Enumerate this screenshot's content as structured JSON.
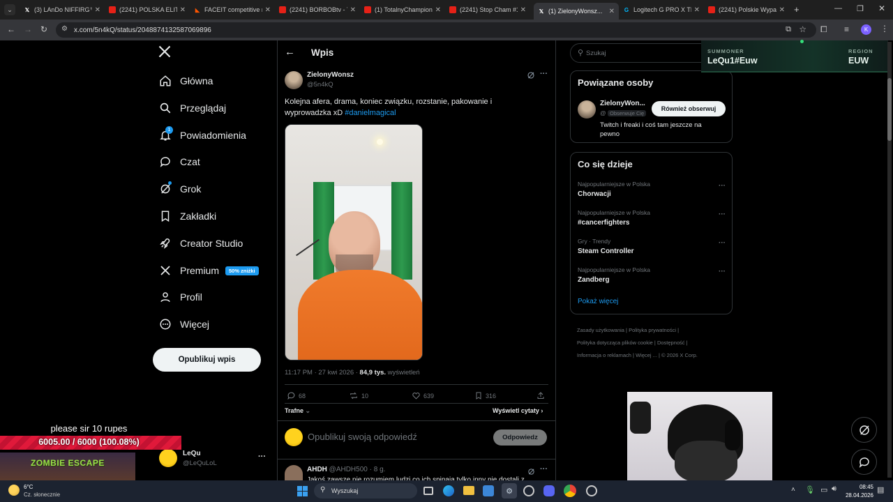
{
  "browser": {
    "tabs": [
      {
        "title": "(3) LAnDo NIFFIRG™...",
        "favicon": "x"
      },
      {
        "title": "(2241) POLSKA ELITA",
        "favicon": "yt"
      },
      {
        "title": "FACEIT competitive m...",
        "favicon": "fc"
      },
      {
        "title": "(2241) BORBOBtv - Yo...",
        "favicon": "yt"
      },
      {
        "title": "(1) TotalnyChampion...",
        "favicon": "yt"
      },
      {
        "title": "(2241) Stop Cham #1...",
        "favicon": "yt"
      },
      {
        "title": "(1) ZielonyWonsz...",
        "favicon": "x",
        "active": true
      },
      {
        "title": "Logitech G PRO X TK...",
        "favicon": "lg"
      },
      {
        "title": "(2241) Polskie Wypad...",
        "favicon": "yt"
      }
    ],
    "url": "x.com/5n4kQ/status/2048874132587069896",
    "profile_initial": "K"
  },
  "nav": {
    "logo": "X",
    "items": [
      {
        "label": "Główna",
        "icon": "home-icon"
      },
      {
        "label": "Przeglądaj",
        "icon": "search-icon"
      },
      {
        "label": "Powiadomienia",
        "icon": "bell-icon",
        "badge": "1"
      },
      {
        "label": "Czat",
        "icon": "chat-icon"
      },
      {
        "label": "Grok",
        "icon": "grok-icon"
      },
      {
        "label": "Zakładki",
        "icon": "bookmark-icon"
      },
      {
        "label": "Creator Studio",
        "icon": "rocket-icon"
      },
      {
        "label": "Premium",
        "icon": "x-premium-icon",
        "badge": "50% zniżki"
      },
      {
        "label": "Profil",
        "icon": "person-icon"
      },
      {
        "label": "Więcej",
        "icon": "more-circle-icon"
      }
    ],
    "post_button": "Opublikuj wpis",
    "account": {
      "name": "LeQu",
      "handle": "@LeQuLoL",
      "more": "···"
    }
  },
  "post": {
    "header_title": "Wpis",
    "author_name": "ZielonyWonsz",
    "author_handle": "@5n4kQ",
    "text": "Kolejna afera, drama, koniec związku, rozstanie, pakowanie i wyprowadzka xD ",
    "hashtag": "#danielmagical",
    "time": "11:17 PM · 27 kwi 2026 · ",
    "views_count": "84,9 tys.",
    "views_label": " wyświetleń",
    "stats": {
      "replies": "68",
      "reposts": "10",
      "likes": "639",
      "bookmarks": "316"
    },
    "sort_label": "Trafne",
    "quotes_label": "Wyświetl cytaty",
    "reply_placeholder": "Opublikuj swoją odpowiedź",
    "reply_button": "Odpowiedz",
    "next_reply": {
      "name": "AHDH",
      "handle": "@AHDH500 · 8 g.",
      "text": "Jakoś zawsze nie rozumiem ludzi co ich spinają tylko inny nie dostali z..."
    }
  },
  "sidebar": {
    "search_placeholder": "Szukaj",
    "related": {
      "title": "Powiązane osoby",
      "name": "ZielonyWon...",
      "handle": "@",
      "follows_you": "Obserwuje Cię",
      "follow_button": "Również obserwuj",
      "bio": "Twitch i freaki i coś tam jeszcze na pewno"
    },
    "trends_title": "Co się dzieje",
    "trends": [
      {
        "category": "Najpopularniejsze w Polska",
        "name": "Chorwacji"
      },
      {
        "category": "Najpopularniejsze w Polska",
        "name": "#cancerfighters"
      },
      {
        "category": "Gry · Trendy",
        "name": "Steam Controller"
      },
      {
        "category": "Najpopularniejsze w Polska",
        "name": "Zandberg"
      }
    ],
    "show_more": "Pokaż więcej",
    "footer": [
      "Zasady użytkowania",
      "Polityka prywatności",
      "Polityka dotycząca plików cookie",
      "Dostępność",
      "Informacja o reklamach",
      "Więcej ...",
      "© 2026 X Corp."
    ]
  },
  "overlay": {
    "summoner_label": "SUMMONER",
    "summoner_value": "LeQu1#Euw",
    "region_label": "REGION",
    "region_value": "EUW",
    "donation_text": "please sir 10 rupes",
    "goal_text": "6005.00 / 6000 (100.08%)",
    "goal_progress": 1.0,
    "game_banner": "ZOMBIE ESCAPE"
  },
  "taskbar": {
    "weather_temp": "6°C",
    "weather_desc": "Cz. słonecznie",
    "search_label": "Wyszukaj",
    "time": "08:45",
    "date": "28.04.2026"
  },
  "colors": {
    "accent": "#1d9bf0",
    "goal_bar": "#e0193a",
    "premium_badge": "#1d9bf0"
  }
}
